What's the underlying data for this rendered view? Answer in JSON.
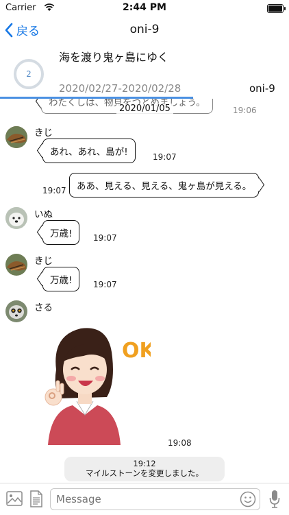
{
  "status": {
    "carrier": "Carrier",
    "time": "2:44 PM"
  },
  "nav": {
    "back_label": "戻る",
    "title": "oni-9"
  },
  "milestone": {
    "progress_number": "2",
    "title": "海を渡り鬼ヶ島にゆく",
    "dates": "2020/02/27-2020/02/28",
    "code": "oni-9",
    "progress_fraction": 0.67
  },
  "messages": {
    "partial_text": "わたくしは、物見をつとめましょう。",
    "partial_time": "19:06",
    "date_label": "2020/01/05",
    "m1": {
      "sender": "きじ",
      "text": "あれ、あれ、島が!",
      "time": "19:07"
    },
    "m2": {
      "text": "ああ、見える、見える、鬼ヶ島が見える。",
      "time": "19:07"
    },
    "m3": {
      "sender": "いぬ",
      "text": "万歳!",
      "time": "19:07"
    },
    "m4": {
      "sender": "きじ",
      "text": "万歳!",
      "time": "19:07"
    },
    "m5": {
      "sender": "さる",
      "sticker_text": "OK!",
      "time": "19:08"
    },
    "system": {
      "time": "19:12",
      "text": "マイルストーンを変更しました。"
    }
  },
  "input": {
    "placeholder": "Message"
  },
  "colors": {
    "accent": "#1677e5",
    "progress": "#4a90e2"
  }
}
